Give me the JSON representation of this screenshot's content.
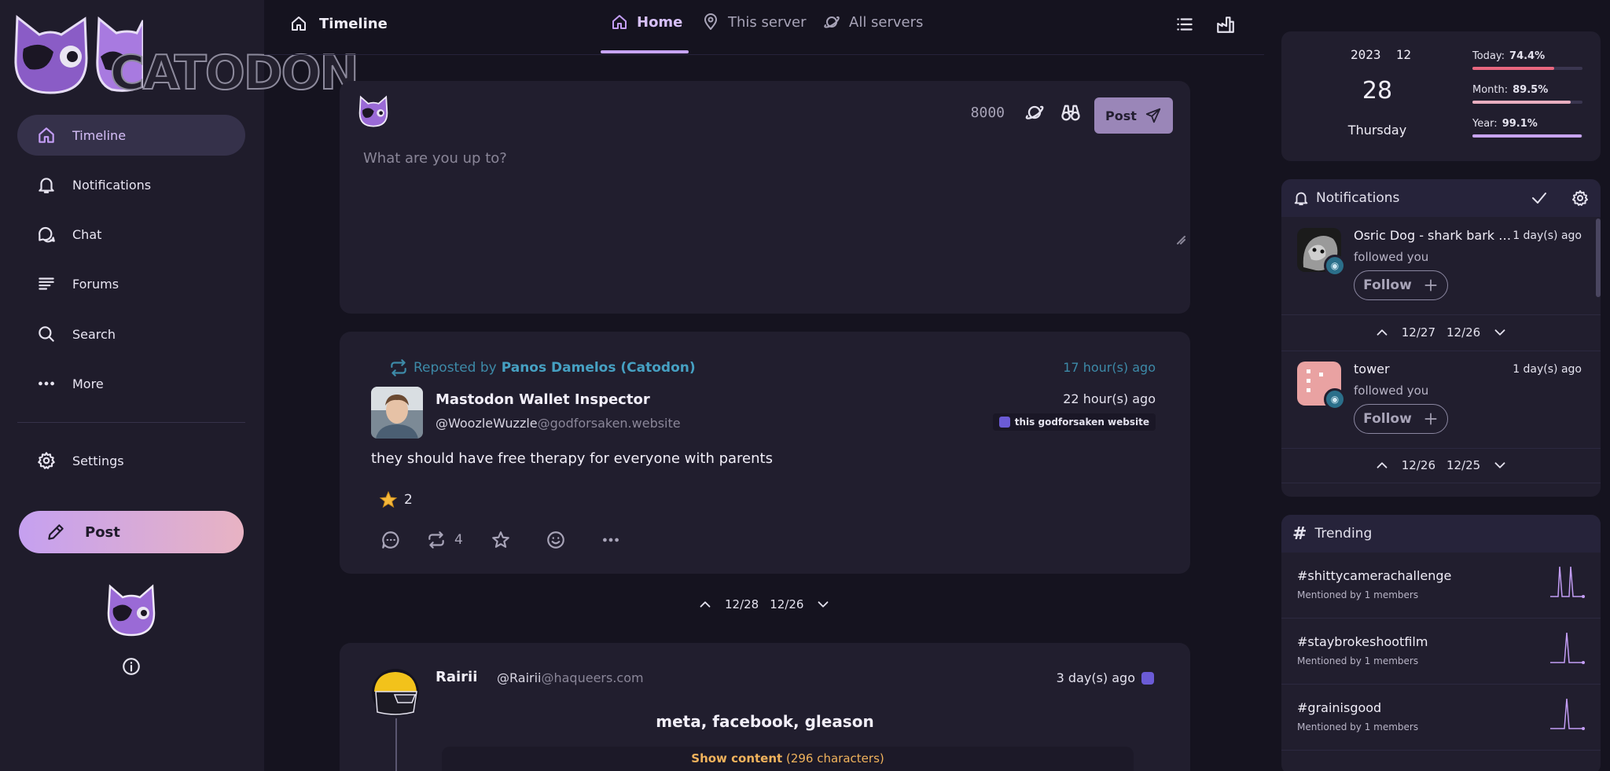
{
  "sidebar": {
    "logo_text": "CATODON",
    "items": [
      {
        "label": "Timeline",
        "icon": "home-icon"
      },
      {
        "label": "Notifications",
        "icon": "bell-icon"
      },
      {
        "label": "Chat",
        "icon": "chat-icon"
      },
      {
        "label": "Forums",
        "icon": "forums-icon"
      },
      {
        "label": "Search",
        "icon": "search-icon"
      },
      {
        "label": "More",
        "icon": "more-icon"
      }
    ],
    "settings_label": "Settings",
    "post_label": "Post"
  },
  "header": {
    "title": "Timeline",
    "tabs": [
      {
        "label": "Home",
        "icon": "home-icon"
      },
      {
        "label": "This server",
        "icon": "map-pin-icon"
      },
      {
        "label": "All servers",
        "icon": "planet-icon"
      }
    ]
  },
  "composer": {
    "counter": "8000",
    "placeholder": "What are you up to?",
    "post_label": "Post"
  },
  "post1": {
    "repost_prefix": "Reposted by",
    "reposter": "Panos Damelos (Catodon)",
    "repost_time": "17 hour(s) ago",
    "author": "Mastodon Wallet Inspector",
    "handle": "@WoozleWuzzle",
    "domain": "@godforsaken.website",
    "time": "22 hour(s) ago",
    "instance": "this godforsaken website",
    "text": "they should have free therapy for everyone with parents",
    "star_count": "2",
    "repost_count": "4"
  },
  "pager": {
    "prev": "12/28",
    "next": "12/26"
  },
  "post2": {
    "author": "Rairii",
    "handle": "@Rairii",
    "domain": "@haqueers.com",
    "time": "3 day(s) ago",
    "cw": "meta, facebook, gleason",
    "show_label": "Show content",
    "show_count": "(296 characters)"
  },
  "datecard": {
    "year": "2023",
    "month": "12",
    "day": "28",
    "weekday": "Thursday",
    "progress": [
      {
        "label": "Today:",
        "value": "74.4%",
        "fraction": 0.744,
        "color": "#e8677f"
      },
      {
        "label": "Month:",
        "value": "89.5%",
        "fraction": 0.895,
        "color": "#e8aebf"
      },
      {
        "label": "Year:",
        "value": "99.1%",
        "fraction": 0.991,
        "color": "#c8a4f0"
      }
    ]
  },
  "notifications": {
    "title": "Notifications",
    "items": [
      {
        "name": "Osric Dog - shark bark ed...",
        "time": "1 day(s) ago",
        "action": "followed you",
        "follow_label": "Follow"
      },
      {
        "name": "tower",
        "time": "1 day(s) ago",
        "action": "followed you",
        "follow_label": "Follow"
      }
    ],
    "pagers": [
      {
        "prev": "12/27",
        "next": "12/26"
      },
      {
        "prev": "12/26",
        "next": "12/25"
      }
    ]
  },
  "trending": {
    "title": "Trending",
    "items": [
      {
        "tag": "#shittycamerachallenge",
        "sub": "Mentioned by 1 members"
      },
      {
        "tag": "#staybrokeshootfilm",
        "sub": "Mentioned by 1 members"
      },
      {
        "tag": "#grainisgood",
        "sub": "Mentioned by 1 members"
      }
    ],
    "spark_color": "#c39df5"
  }
}
